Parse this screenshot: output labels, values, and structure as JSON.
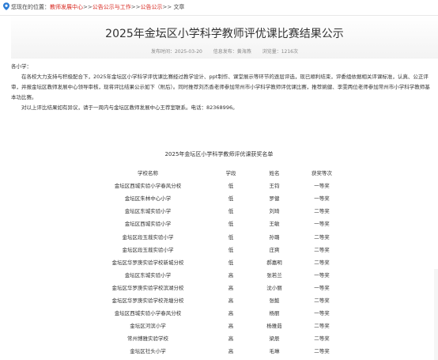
{
  "breadcrumb": {
    "prefix": "您现在的位置：",
    "items": [
      "教师发展中心",
      "公告公示与工作",
      "公告公示"
    ],
    "separator": ">>",
    "current": "文章"
  },
  "article": {
    "title": "2025年金坛区小学科学教师评优课比赛结果公示",
    "publish_time": "发布时间：2025-03-20",
    "publisher": "信息发布：黄海燕",
    "views": "浏览量：1216次",
    "greeting": "各小学：",
    "paragraph1": "在各校大力支持与积极配合下，2025年金坛区小学科学评优课比赛经过教学设计、ppt制作、课堂展示等环节的逐层评选，现已顺利结束，评委组依据相关评课标准，认真、公正评审，并报金坛区教师发展中心领导审核，现将评比结果公示如下（附后）。同时推荐刘杰香老师参加常州市小学科学教师评优课比赛，推荐姚健、李雯两位老师参加常州市小学科学教师基本功比赛。",
    "paragraph2": "对以上评比结果如有异议，请于一周内与金坛区教师发展中心王荐室联系。电话：82368996。"
  },
  "table": {
    "title": "2025年金坛区小学科学教师评优课获奖名单",
    "headers": [
      "学校名称",
      "学段",
      "姓名",
      "获奖等次"
    ],
    "rows": [
      [
        "金坛区西城实验小学春风分校",
        "低",
        "王钧",
        "一等奖"
      ],
      [
        "金坛区朱林中心小学",
        "低",
        "罗健",
        "一等奖"
      ],
      [
        "金坛区东城实验小学",
        "低",
        "刘琦",
        "二等奖"
      ],
      [
        "金坛区西城实验小学",
        "低",
        "王敏",
        "一等奖"
      ],
      [
        "金坛区段玉裁实验小学",
        "低",
        "孙璐",
        "二等奖"
      ],
      [
        "金坛区段玉裁实验小学",
        "低",
        "庄爽",
        "二等奖"
      ],
      [
        "金坛区华罗庚实验学校新城分校",
        "低",
        "郝嘉明",
        "二等奖"
      ],
      [
        "金坛区东城实验小学",
        "高",
        "张若兰",
        "一等奖"
      ],
      [
        "金坛区华罗庚实验学校滨湖分校",
        "高",
        "沈小丽",
        "一等奖"
      ],
      [
        "金坛区华罗庚实验学校尧塘分校",
        "高",
        "张懿",
        "二等奖"
      ],
      [
        "金坛区西城实验小学春风分校",
        "高",
        "杨丽",
        "一等奖"
      ],
      [
        "金坛区河滨小学",
        "高",
        "杨雅茹",
        "二等奖"
      ],
      [
        "常州博雅实验学校",
        "高",
        "梁辰",
        "二等奖"
      ],
      [
        "金坛区社头小学",
        "高",
        "毛琳",
        "二等奖"
      ]
    ]
  }
}
